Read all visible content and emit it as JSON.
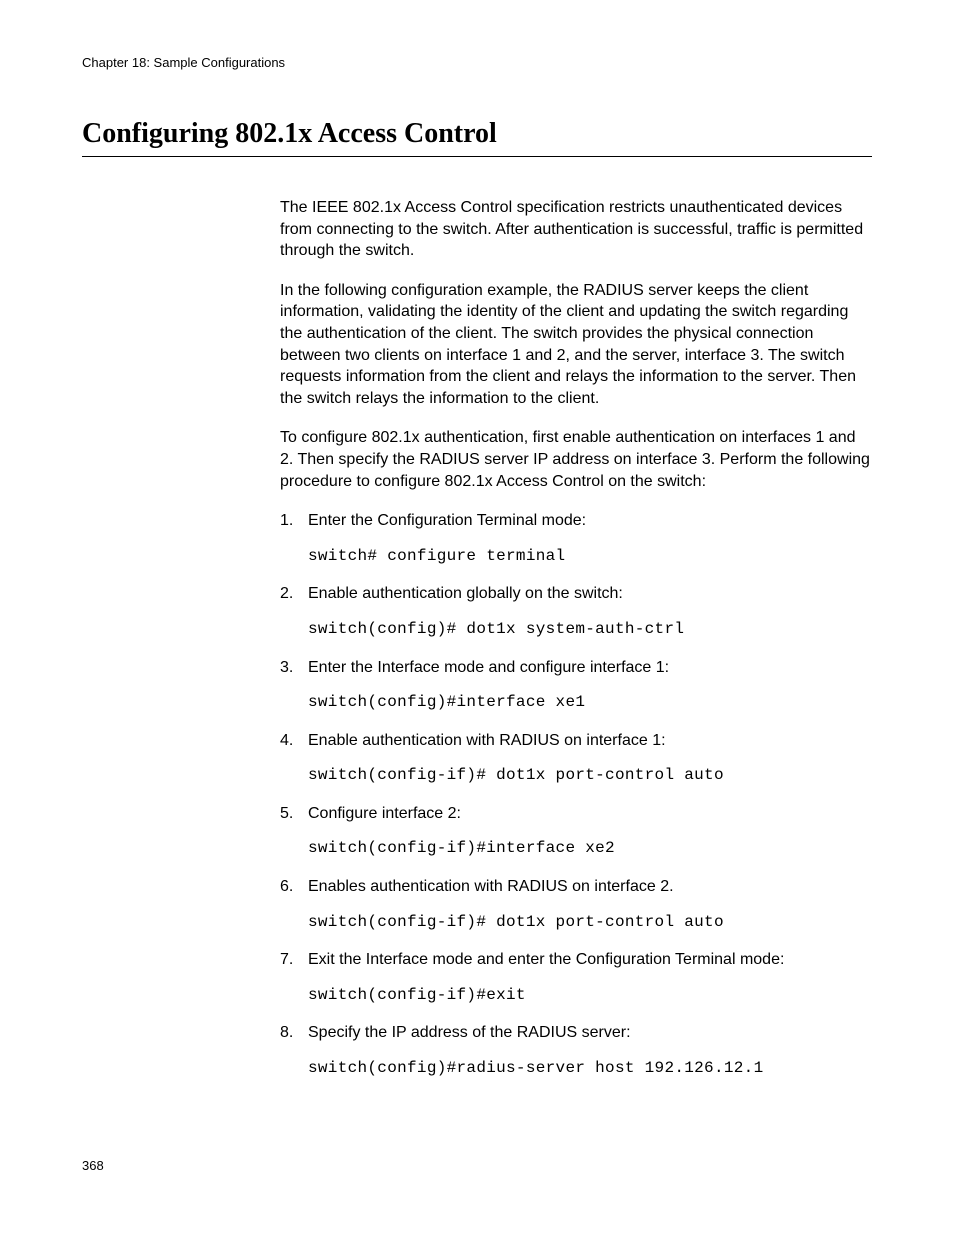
{
  "header": {
    "chapter_line": "Chapter 18: Sample Configurations"
  },
  "section_title": "Configuring 802.1x Access Control",
  "paragraphs": {
    "p1": "The IEEE 802.1x Access Control specification restricts unauthenticated devices from connecting to the switch. After authentication is successful, traffic is permitted through the switch.",
    "p2": "In the following configuration example, the RADIUS server keeps the client information, validating the identity of the client and updating the switch regarding the authentication of the client. The switch provides the physical connection between two clients on interface 1 and 2, and the server, interface 3. The switch requests information from the client and relays the information to the server. Then the switch relays the information to the client.",
    "p3": "To configure 802.1x authentication, first enable authentication on interfaces 1 and 2. Then specify the RADIUS server IP address on interface 3. Perform the following procedure to configure 802.1x Access Control on the switch:"
  },
  "steps": [
    {
      "num": "1.",
      "text": "Enter the Configuration Terminal mode:",
      "cmd": "switch# configure terminal"
    },
    {
      "num": "2.",
      "text": "Enable authentication globally on the switch:",
      "cmd": "switch(config)# dot1x system-auth-ctrl"
    },
    {
      "num": "3.",
      "text": "Enter the Interface mode and configure interface 1:",
      "cmd": "switch(config)#interface xe1"
    },
    {
      "num": "4.",
      "text": "Enable authentication with RADIUS on interface 1:",
      "cmd": "switch(config-if)# dot1x port-control auto"
    },
    {
      "num": "5.",
      "text": "Configure interface 2:",
      "cmd": "switch(config-if)#interface xe2"
    },
    {
      "num": "6.",
      "text": "Enables authentication with RADIUS on interface 2.",
      "cmd": "switch(config-if)# dot1x port-control auto"
    },
    {
      "num": "7.",
      "text": "Exit the Interface mode and enter the Configuration Terminal mode:",
      "cmd": "switch(config-if)#exit"
    },
    {
      "num": "8.",
      "text": "Specify the IP address of the RADIUS server:",
      "cmd": "switch(config)#radius-server host 192.126.12.1"
    }
  ],
  "page_number": "368"
}
